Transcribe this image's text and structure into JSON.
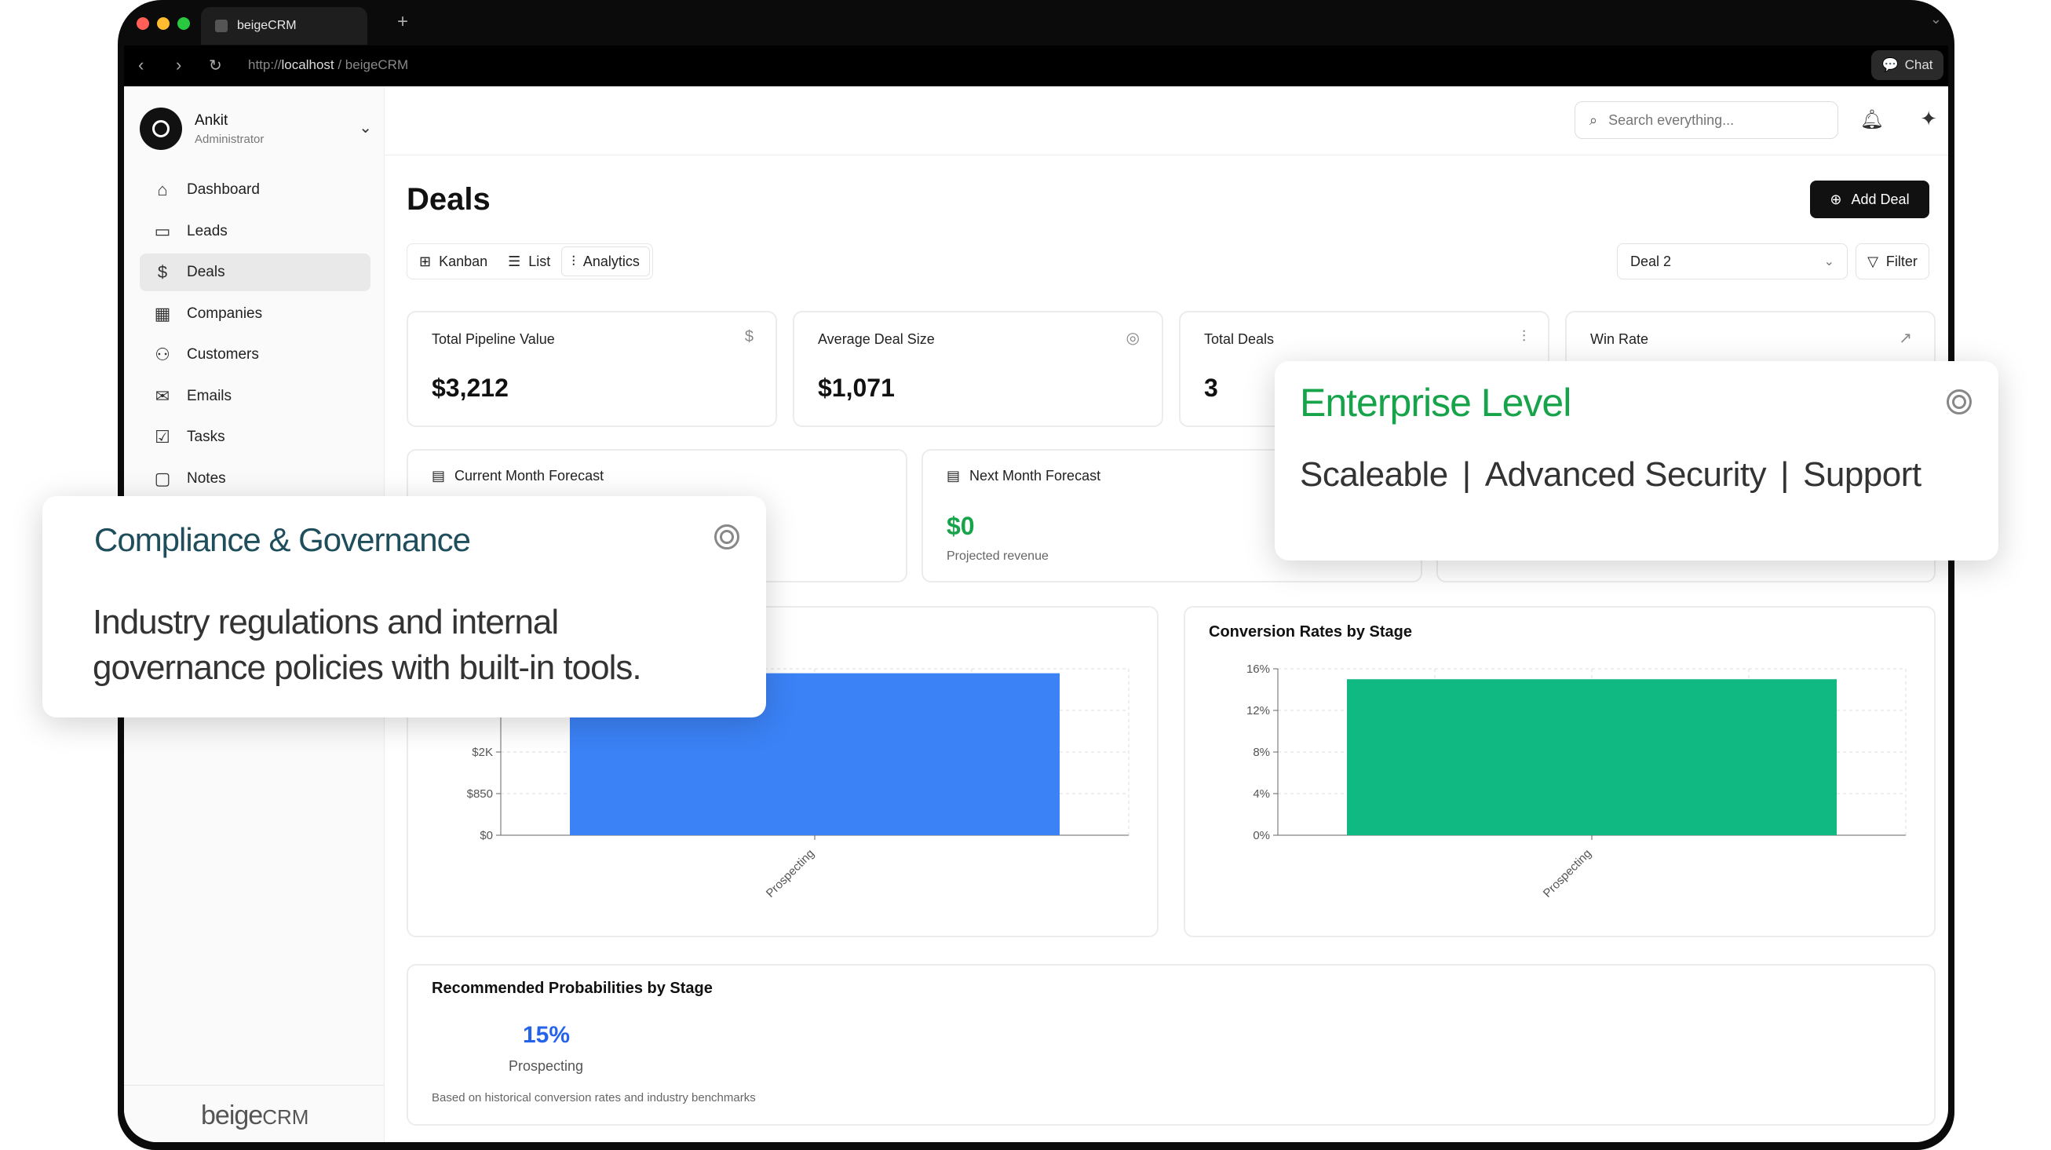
{
  "browser": {
    "tab_title": "beigeCRM",
    "url_prefix": "http://",
    "url_host": "localhost",
    "url_path": " / beigeCRM",
    "chat_label": "Chat"
  },
  "user": {
    "name": "Ankit",
    "role": "Administrator"
  },
  "sidebar": {
    "items": [
      {
        "label": "Dashboard",
        "icon": "home-icon"
      },
      {
        "label": "Leads",
        "icon": "briefcase-icon"
      },
      {
        "label": "Deals",
        "icon": "dollar-icon",
        "active": true
      },
      {
        "label": "Companies",
        "icon": "building-icon"
      },
      {
        "label": "Customers",
        "icon": "users-icon"
      },
      {
        "label": "Emails",
        "icon": "inbox-icon"
      },
      {
        "label": "Tasks",
        "icon": "checkbox-icon"
      },
      {
        "label": "Notes",
        "icon": "note-icon"
      }
    ],
    "brand_main": "beige",
    "brand_suffix": "CRM"
  },
  "topbar": {
    "search_placeholder": "Search everything..."
  },
  "page": {
    "title": "Deals",
    "add_deal_label": "Add Deal",
    "view_tabs": [
      {
        "label": "Kanban"
      },
      {
        "label": "List"
      },
      {
        "label": "Analytics",
        "active": true
      }
    ],
    "deal_select_value": "Deal 2",
    "filter_label": "Filter"
  },
  "stats": [
    {
      "label": "Total Pipeline Value",
      "value": "$3,212",
      "icon": "dollar-icon"
    },
    {
      "label": "Average Deal Size",
      "value": "$1,071",
      "icon": "target-icon"
    },
    {
      "label": "Total Deals",
      "value": "3",
      "icon": "bar-chart-icon"
    },
    {
      "label": "Win Rate",
      "value": "",
      "icon": "trending-up-icon"
    }
  ],
  "forecasts": [
    {
      "label": "Current Month Forecast"
    },
    {
      "label": "Next Month Forecast",
      "value": "$0",
      "sub": "Projected revenue"
    }
  ],
  "chart_data": [
    {
      "type": "bar",
      "title": "",
      "categories": [
        "Prospecting"
      ],
      "values": [
        3212
      ],
      "yticks": [
        "$0",
        "$850",
        "$2K"
      ],
      "color": "#3b82f6"
    },
    {
      "type": "bar",
      "title": "Conversion Rates by Stage",
      "categories": [
        "Prospecting"
      ],
      "values": [
        15
      ],
      "yticks": [
        "0%",
        "4%",
        "8%",
        "12%",
        "16%"
      ],
      "ylim": [
        0,
        16
      ],
      "color": "#10b981"
    }
  ],
  "recommended": {
    "title": "Recommended Probabilities by Stage",
    "value": "15%",
    "stage": "Prospecting",
    "note": "Based on historical conversion rates and industry benchmarks"
  },
  "popups": {
    "enterprise": {
      "title": "Enterprise Level",
      "features": [
        "Scaleable",
        "Advanced Security",
        "Support"
      ],
      "title_color": "#16a34a"
    },
    "compliance": {
      "title": "Compliance & Governance",
      "body_line1": "Industry regulations and internal",
      "body_line2": "governance policies with built-in tools.",
      "title_color": "#1e4d5c"
    }
  }
}
